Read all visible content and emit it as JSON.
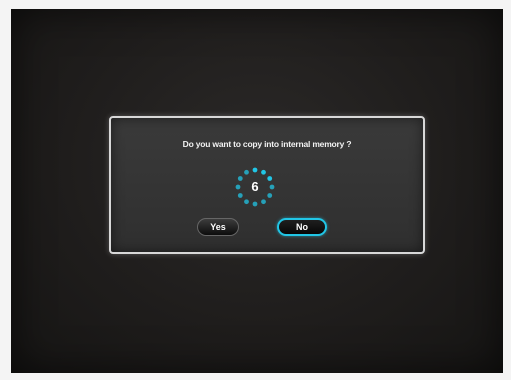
{
  "dialog": {
    "message": "Do you want to copy into internal memory ?",
    "countdown": "6",
    "yes_label": "Yes",
    "no_label": "No",
    "selected_button": "No"
  },
  "colors": {
    "accent": "#21c6e6",
    "dialog_border": "#d8d8d8",
    "screen_background": "#1f1d1c"
  },
  "icons": {
    "countdown_spinner": "dotted-ring-spinner-icon"
  }
}
